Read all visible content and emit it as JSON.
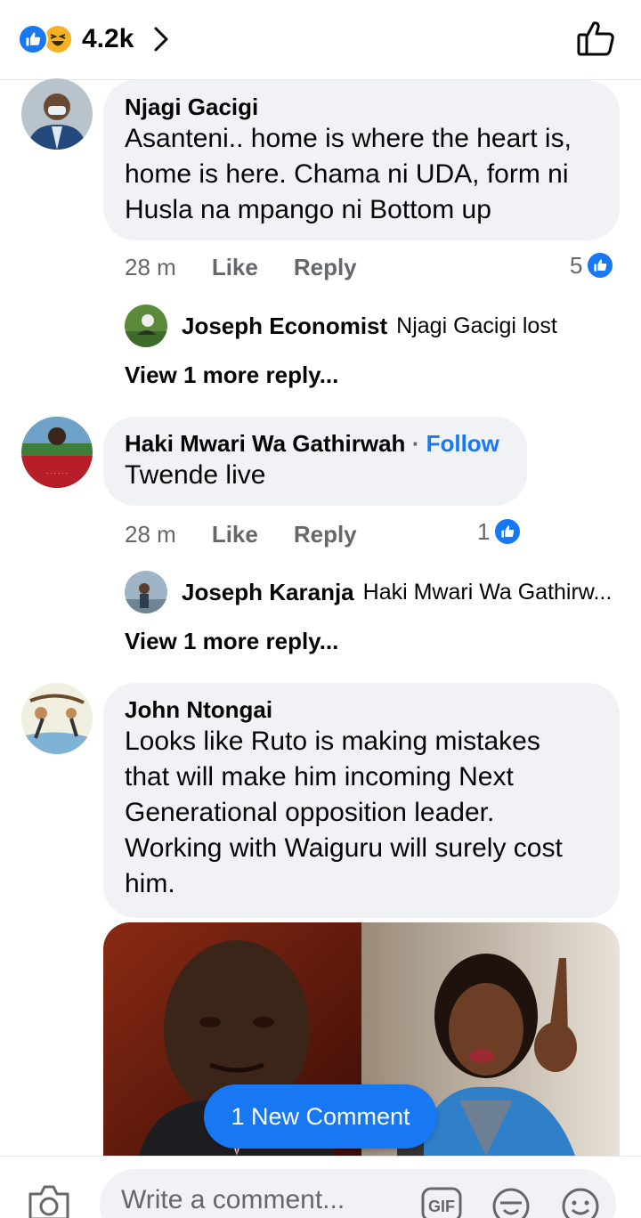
{
  "header": {
    "reaction_icons": [
      "like-icon",
      "haha-icon"
    ],
    "reaction_count": "4.2k",
    "like_icon": "thumbs-up-outline-icon"
  },
  "comments": [
    {
      "author": "Njagi Gacigi",
      "text_lines": [
        "Asanteni.. home is where the heart is,",
        "home is here. Chama ni UDA, form ni",
        "Husla na mpango ni Bottom up"
      ],
      "time": "28 m",
      "like_label": "Like",
      "reply_label": "Reply",
      "reactions": "5",
      "reply_preview": {
        "author": "Joseph Economist",
        "text": "Njagi Gacigi lost"
      },
      "view_more": "View 1 more reply..."
    },
    {
      "author": "Haki Mwari Wa Gathirwah",
      "follow_separator": "·",
      "follow_label": "Follow",
      "text_lines": [
        "Twende live"
      ],
      "time": "28 m",
      "like_label": "Like",
      "reply_label": "Reply",
      "reactions": "1",
      "reply_preview": {
        "author": "Joseph Karanja",
        "text": "Haki Mwari Wa Gathirw..."
      },
      "view_more": "View 1 more reply..."
    },
    {
      "author": "John Ntongai",
      "text_lines": [
        "Looks like Ruto is making mistakes",
        "that will make him incoming Next",
        "Generational opposition leader.",
        "Working with Waiguru will surely cost",
        "him."
      ]
    }
  ],
  "new_comment_pill": "1 New Comment",
  "composer": {
    "placeholder": "Write a comment...",
    "icons": [
      "camera-icon",
      "gif-icon",
      "sticker-icon",
      "emoji-icon"
    ]
  },
  "colors": {
    "accent": "#1877f2",
    "bubble": "#f0f2f5",
    "secondary_text": "#65676b"
  }
}
